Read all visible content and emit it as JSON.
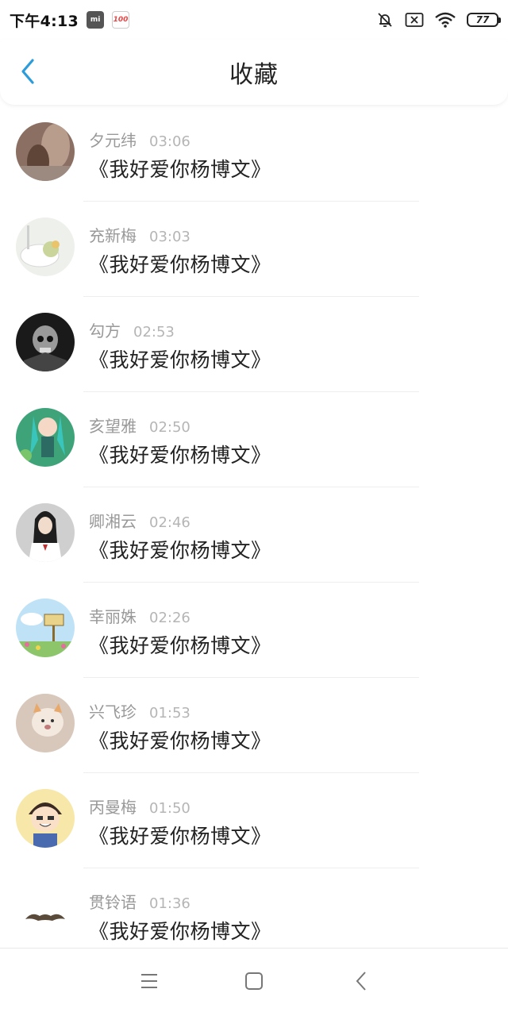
{
  "status_bar": {
    "time": "下午4:13",
    "battery": "77",
    "mi_label": "mi",
    "hundred_label": "100"
  },
  "header": {
    "title": "收藏"
  },
  "items": [
    {
      "author": "夕元纬",
      "time": "03:06",
      "content": "《我好爱你杨博文》"
    },
    {
      "author": "充新梅",
      "time": "03:03",
      "content": "《我好爱你杨博文》"
    },
    {
      "author": "勾方",
      "time": "02:53",
      "content": "《我好爱你杨博文》"
    },
    {
      "author": "亥望雅",
      "time": "02:50",
      "content": "《我好爱你杨博文》"
    },
    {
      "author": "卿湘云",
      "time": "02:46",
      "content": "《我好爱你杨博文》"
    },
    {
      "author": "幸丽姝",
      "time": "02:26",
      "content": "《我好爱你杨博文》"
    },
    {
      "author": "兴飞珍",
      "time": "01:53",
      "content": "《我好爱你杨博文》"
    },
    {
      "author": "丙曼梅",
      "time": "01:50",
      "content": "《我好爱你杨博文》"
    },
    {
      "author": "贯铃语",
      "time": "01:36",
      "content": "《我好爱你杨博文》"
    }
  ],
  "colors": {
    "accent": "#2d9cdb",
    "author_text": "#999999",
    "time_text": "#b5b5b5",
    "content_text": "#222222"
  },
  "icons": {
    "back": "chevron-left-icon",
    "silent": "bell-off-icon",
    "sim": "no-sim-icon",
    "wifi": "wifi-icon",
    "menu": "menu-icon",
    "home": "square-icon",
    "nav_back": "triangle-left-icon"
  }
}
